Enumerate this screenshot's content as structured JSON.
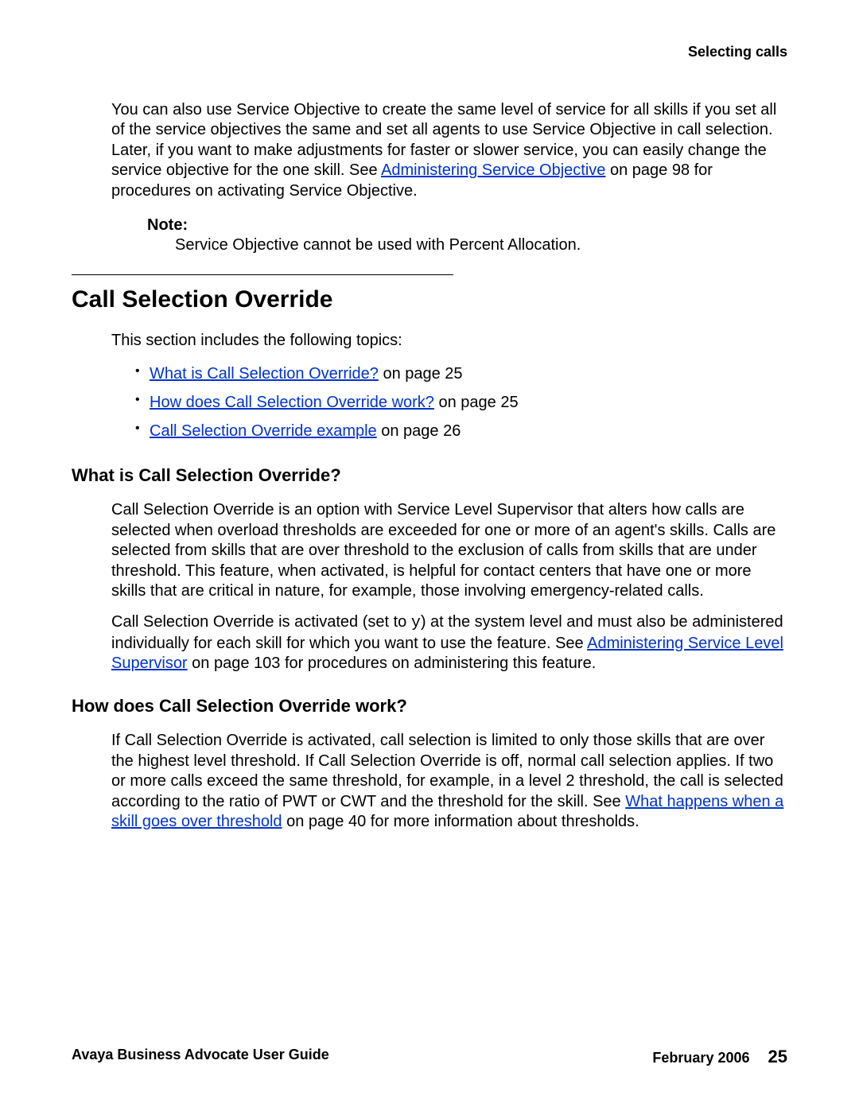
{
  "header": {
    "right": "Selecting calls"
  },
  "intro": {
    "p1a": "You can also use Service Objective to create the same level of service for all skills if you set all of the service objectives the same and set all agents to use Service Objective in call selection. Later, if you want to make adjustments for faster or slower service, you can easily change the service objective for the one skill. See ",
    "link1": "Administering Service Objective",
    "p1b": " on page 98 for procedures on activating Service Objective."
  },
  "note": {
    "label": "Note:",
    "body": "Service Objective cannot be used with Percent Allocation."
  },
  "section": {
    "heading": "Call Selection Override",
    "intro": "This section includes the following topics:",
    "topics": [
      {
        "link": "What is Call Selection Override?",
        "suffix": " on page 25"
      },
      {
        "link": "How does Call Selection Override work?",
        "suffix": " on page 25"
      },
      {
        "link": "Call Selection Override example",
        "suffix": " on page 26"
      }
    ]
  },
  "sub1": {
    "heading": "What is Call Selection Override?",
    "p1": "Call Selection Override is an option with Service Level Supervisor that alters how calls are selected when overload thresholds are exceeded for one or more of an agent's skills. Calls are selected from skills that are over threshold to the exclusion of calls from skills that are under threshold. This feature, when activated, is helpful for contact centers that have one or more skills that are critical in nature, for example, those involving emergency-related calls.",
    "p2a": "Call Selection Override is activated (set to ",
    "p2code": "y",
    "p2b": ") at the system level and must also be administered individually for each skill for which you want to use the feature. See ",
    "p2link": "Administering Service Level Supervisor",
    "p2c": " on page 103 for procedures on administering this feature."
  },
  "sub2": {
    "heading": "How does Call Selection Override work?",
    "p1a": "If Call Selection Override is activated, call selection is limited to only those skills that are over the highest level threshold. If Call Selection Override is off, normal call selection applies. If two or more calls exceed the same threshold, for example, in a level 2 threshold, the call is selected according to the ratio of PWT or CWT and the threshold for the skill. See ",
    "p1link": "What happens when a skill goes over threshold",
    "p1b": " on page 40 for more information about thresholds."
  },
  "footer": {
    "left": "Avaya Business Advocate User Guide",
    "date": "February 2006",
    "page": "25"
  }
}
